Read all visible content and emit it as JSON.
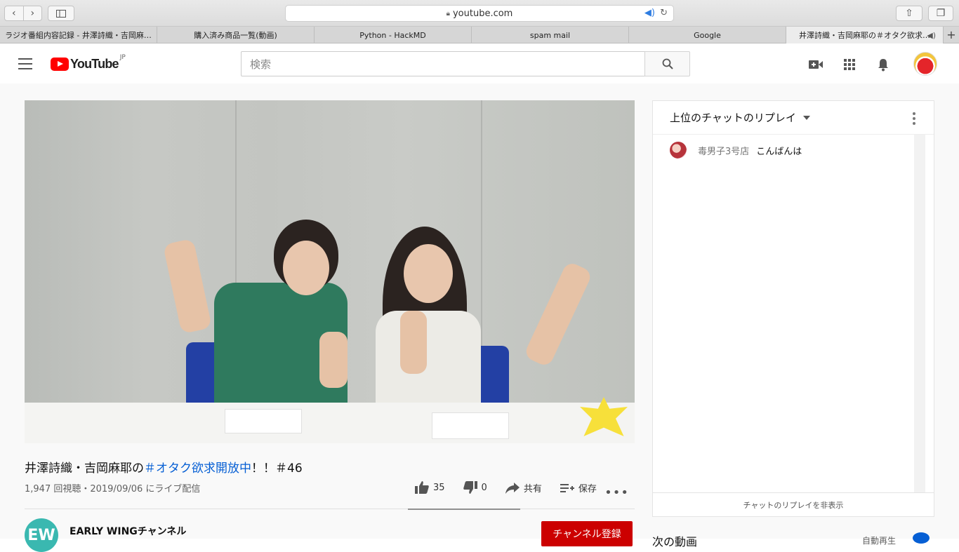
{
  "browser": {
    "address": "youtube.com",
    "tabs": [
      {
        "label": "ラジオ番組内容記録 - 井澤詩織・吉岡麻…"
      },
      {
        "label": "購入済み商品一覧(動画)"
      },
      {
        "label": "Python - HackMD"
      },
      {
        "label": "spam mail"
      },
      {
        "label": "Google"
      },
      {
        "label": "井澤詩織・吉岡麻耶の＃オタク欲求…"
      }
    ]
  },
  "header": {
    "logo_text": "YouTube",
    "logo_region": "JP",
    "search_placeholder": "検索"
  },
  "video": {
    "title_prefix": "井澤詩織・吉岡麻耶の",
    "title_hashtag": "＃オタク欲求開放中",
    "title_suffix": "！！＃46",
    "views_date": "1,947 回視聴・2019/09/06 にライブ配信",
    "likes": "35",
    "dislikes": "0",
    "share_label": "共有",
    "save_label": "保存"
  },
  "channel": {
    "initials": "EW",
    "name": "EARLY WINGチャンネル",
    "subscribe_label": "チャンネル登録"
  },
  "chat": {
    "header": "上位のチャットのリプレイ",
    "messages": [
      {
        "author": "毒男子3号店",
        "text": "こんばんは"
      }
    ],
    "hide_replay": "チャットのリプレイを非表示"
  },
  "sidebar": {
    "next_label": "次の動画",
    "autoplay_label": "自動再生"
  }
}
